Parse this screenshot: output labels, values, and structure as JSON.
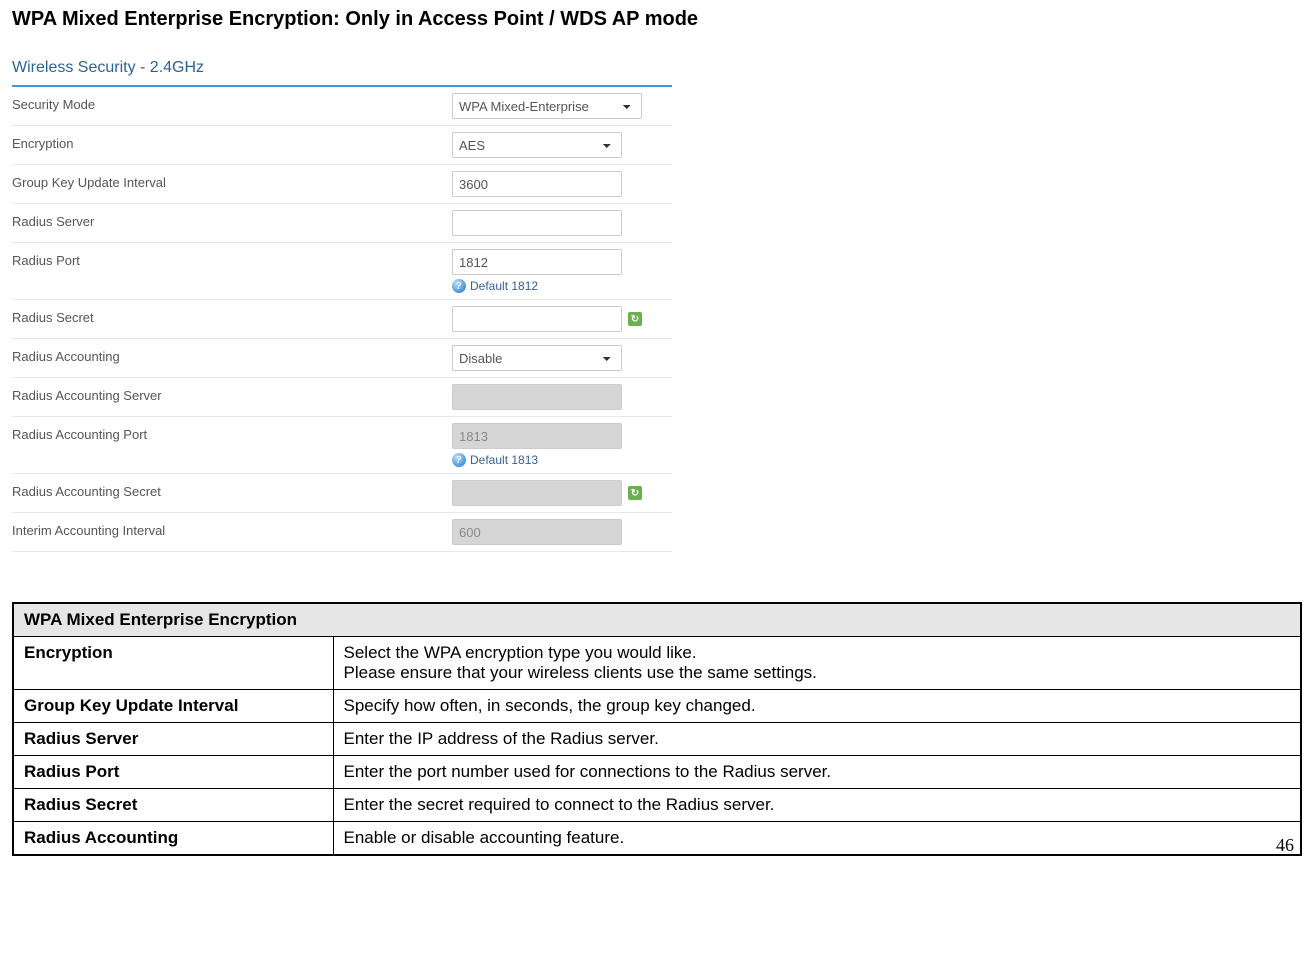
{
  "heading": "WPA Mixed Enterprise Encryption: Only in Access Point / WDS AP mode",
  "panel": {
    "title": "Wireless Security - 2.4GHz",
    "rows": {
      "securityMode": {
        "label": "Security Mode",
        "value": "WPA Mixed-Enterprise"
      },
      "encryption": {
        "label": "Encryption",
        "value": "AES"
      },
      "groupKey": {
        "label": "Group Key Update Interval",
        "value": "3600"
      },
      "radiusServer": {
        "label": "Radius Server",
        "value": ""
      },
      "radiusPort": {
        "label": "Radius Port",
        "value": "1812",
        "hint": "Default 1812"
      },
      "radiusSecret": {
        "label": "Radius Secret",
        "value": ""
      },
      "radiusAccounting": {
        "label": "Radius Accounting",
        "value": "Disable"
      },
      "radiusAcctServer": {
        "label": "Radius Accounting Server",
        "value": ""
      },
      "radiusAcctPort": {
        "label": "Radius Accounting Port",
        "value": "1813",
        "hint": "Default 1813"
      },
      "radiusAcctSecret": {
        "label": "Radius Accounting Secret",
        "value": ""
      },
      "interimInterval": {
        "label": "Interim Accounting Interval",
        "value": "600"
      }
    }
  },
  "table": {
    "header": "WPA Mixed Enterprise Encryption",
    "rows": [
      {
        "label": "Encryption",
        "desc": "Select the WPA encryption type you would like.\nPlease ensure that your wireless clients use the same settings."
      },
      {
        "label": "Group Key Update Interval",
        "desc": "Specify how often, in seconds, the group key changed."
      },
      {
        "label": "Radius Server",
        "desc": "Enter the IP address of the Radius server."
      },
      {
        "label": "Radius Port",
        "desc": "Enter the port number used for connections to the Radius server."
      },
      {
        "label": "Radius Secret",
        "desc": "Enter the secret required to connect to the Radius server."
      },
      {
        "label": "Radius Accounting",
        "desc": "Enable or disable accounting feature."
      }
    ]
  },
  "pageNumber": "46"
}
